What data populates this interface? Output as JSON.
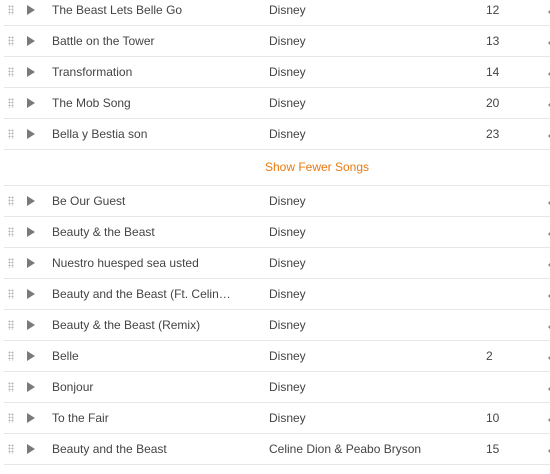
{
  "accent_color": "#e87a11",
  "top_songs": [
    {
      "title": "The Beast Lets Belle Go",
      "artist": "Disney",
      "plays": "12"
    },
    {
      "title": "Battle on the Tower",
      "artist": "Disney",
      "plays": "13"
    },
    {
      "title": "Transformation",
      "artist": "Disney",
      "plays": "14"
    },
    {
      "title": "The Mob Song",
      "artist": "Disney",
      "plays": "20"
    },
    {
      "title": "Bella y Bestia son",
      "artist": "Disney",
      "plays": "23"
    }
  ],
  "show_fewer_label": "Show Fewer Songs",
  "more_songs": [
    {
      "title": "Be Our Guest",
      "artist": "Disney",
      "plays": ""
    },
    {
      "title": "Beauty & the Beast",
      "artist": "Disney",
      "plays": ""
    },
    {
      "title": "Nuestro huesped sea usted",
      "artist": "Disney",
      "plays": ""
    },
    {
      "title": "Beauty and the Beast (Ft. Celin…",
      "artist": "Disney",
      "plays": ""
    },
    {
      "title": "Beauty & the Beast (Remix)",
      "artist": "Disney",
      "plays": ""
    },
    {
      "title": "Belle",
      "artist": "Disney",
      "plays": "2"
    },
    {
      "title": "Bonjour",
      "artist": "Disney",
      "plays": ""
    },
    {
      "title": "To the Fair",
      "artist": "Disney",
      "plays": "10"
    },
    {
      "title": "Beauty and the Beast",
      "artist": "Celine Dion & Peabo Bryson",
      "plays": "15"
    }
  ]
}
